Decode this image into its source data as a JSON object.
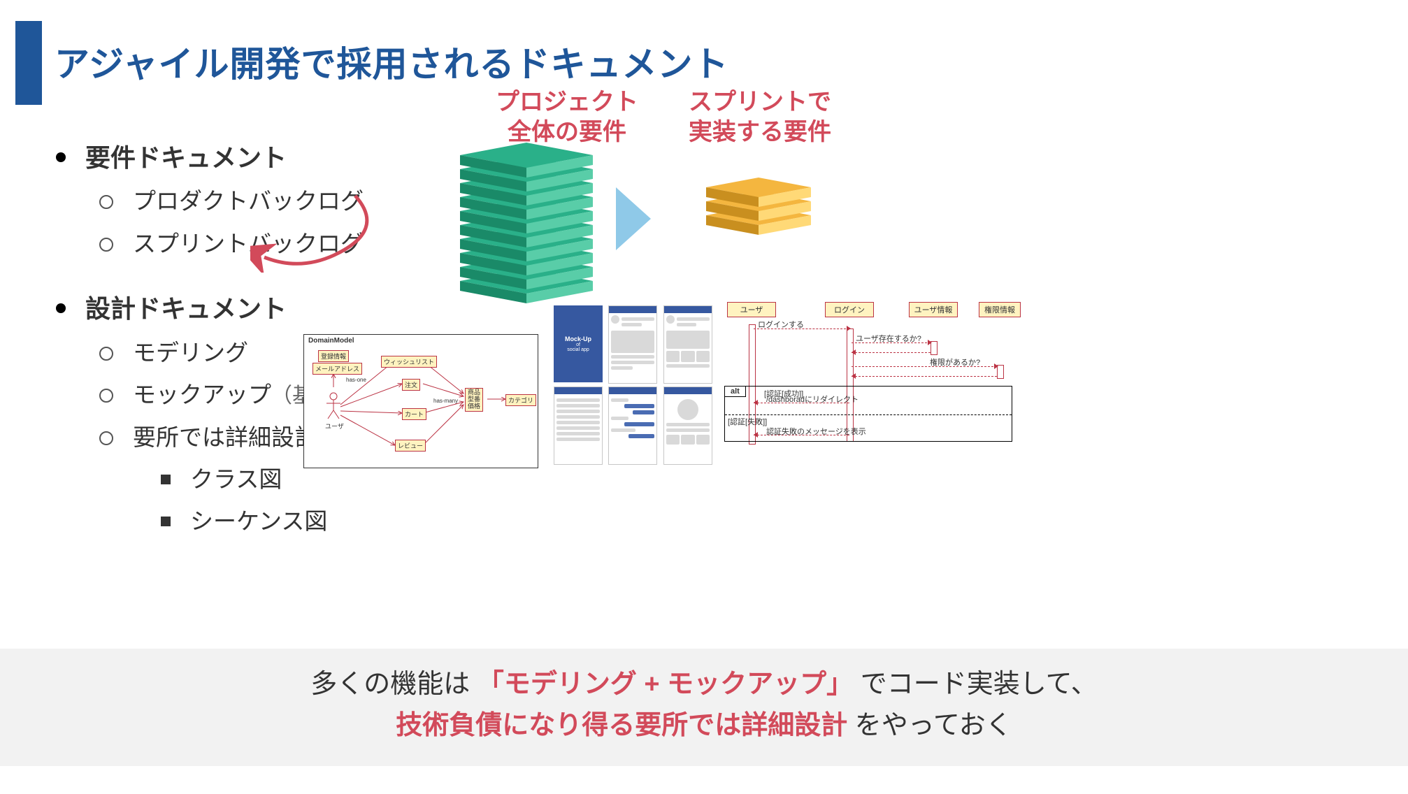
{
  "title": "アジャイル開発で採用されるドキュメント",
  "bullets": {
    "req": {
      "label": "要件ドキュメント",
      "children": [
        "プロダクトバックログ",
        "スプリントバックログ"
      ]
    },
    "des": {
      "label": "設計ドキュメント",
      "children": [
        {
          "t": "モデリング"
        },
        {
          "t": "モックアップ",
          "note": "（基本設計の代わり）"
        },
        {
          "t": "要所では詳細設計",
          "sub": [
            "クラス図",
            "シーケンス図"
          ]
        }
      ]
    }
  },
  "captions": {
    "project": "プロジェクト\n全体の要件",
    "sprint": "スプリントで\n実装する要件"
  },
  "domain": {
    "title": "DomainModel",
    "nodes": {
      "reg": "登録情報",
      "mail": "メールアドレス",
      "user": "ユーザ",
      "wish": "ウィッシュリスト",
      "order": "注文",
      "cart": "カート",
      "review": "レビュー",
      "product": "商品\n型番\n価格",
      "category": "カテゴリ"
    },
    "edges": {
      "hasone": "has-one",
      "hasmany": "has-many"
    }
  },
  "mockup": {
    "hero_l1": "Mock-Up",
    "hero_l2": "of",
    "hero_l3": "social app"
  },
  "seq": {
    "lifelines": [
      "ユーザ",
      "ログイン",
      "ユーザ情報",
      "権限情報"
    ],
    "msgs": {
      "login": "ログインする",
      "exists": "ユーザ存在するか?",
      "perm": "権限があるか?",
      "redirect": "/dashboradにリダイレクト",
      "fail": "認証失敗のメッセージを表示"
    },
    "alt": {
      "label": "alt",
      "guard1": "[認証[成功]]",
      "guard2": "[認証[失敗]]"
    }
  },
  "footer": {
    "pre1": "多くの機能は",
    "accent1": "「モデリング + モックアップ」",
    "post1": "でコード実装して、",
    "accent2": "技術負債になり得る要所では詳細設計",
    "post2": "をやっておく"
  }
}
